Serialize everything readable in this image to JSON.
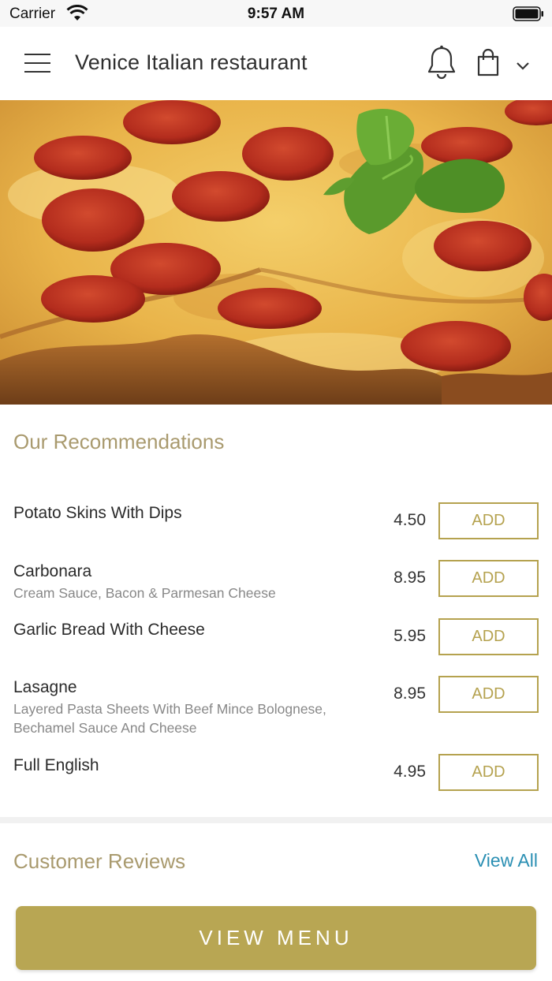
{
  "status_bar": {
    "carrier": "Carrier",
    "time": "9:57 AM"
  },
  "header": {
    "title": "Venice Italian restaurant"
  },
  "recommendations": {
    "title": "Our Recommendations",
    "add_label": "ADD",
    "items": [
      {
        "name": "Potato Skins With Dips",
        "description": "",
        "price": "4.50"
      },
      {
        "name": "Carbonara",
        "description": "Cream Sauce, Bacon & Parmesan Cheese",
        "price": "8.95"
      },
      {
        "name": "Garlic Bread With Cheese",
        "description": "",
        "price": "5.95"
      },
      {
        "name": "Lasagne",
        "description": "Layered Pasta Sheets With Beef Mince Bolognese, Bechamel Sauce And Cheese",
        "price": "8.95"
      },
      {
        "name": "Full English",
        "description": "",
        "price": "4.95"
      }
    ]
  },
  "reviews": {
    "title": "Customer Reviews",
    "view_all": "View All"
  },
  "footer": {
    "view_menu": "VIEW MENU"
  },
  "colors": {
    "accent": "#b8a653",
    "section_title": "#a99a6e",
    "link": "#2a8fb3"
  },
  "icons": [
    "wifi-icon",
    "battery-icon",
    "hamburger-menu-icon",
    "bell-icon",
    "shopping-bag-icon",
    "chevron-down-icon"
  ]
}
